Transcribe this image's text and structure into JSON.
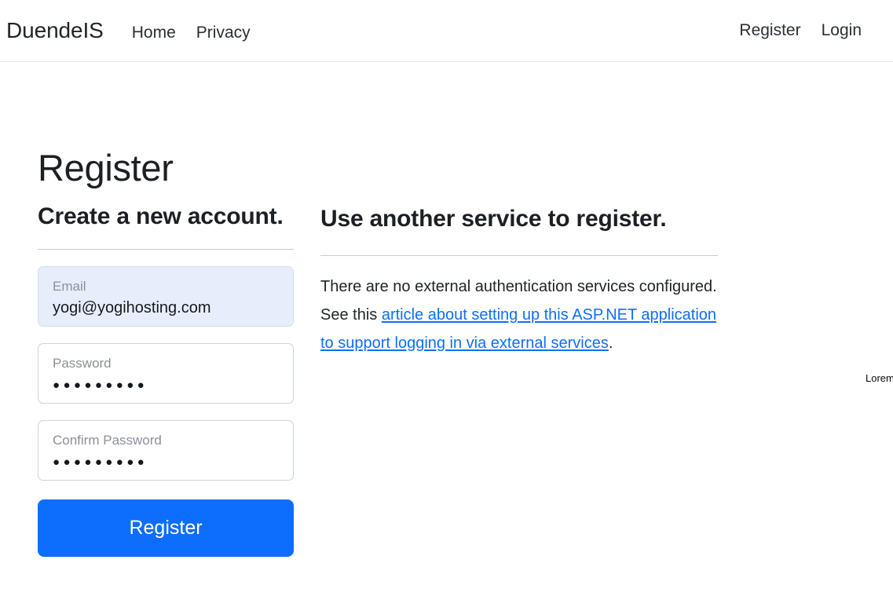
{
  "navbar": {
    "brand": "DuendeIS",
    "links": [
      {
        "label": "Home"
      },
      {
        "label": "Privacy"
      }
    ],
    "auth_links": [
      {
        "label": "Register"
      },
      {
        "label": "Login"
      }
    ]
  },
  "page": {
    "title": "Register"
  },
  "form_section": {
    "heading": "Create a new account.",
    "fields": [
      {
        "name": "email",
        "label": "Email",
        "placeholder": "Email",
        "value": "yogi@yogihosting.com",
        "type": "email",
        "focused": true
      },
      {
        "name": "password",
        "label": "Password",
        "placeholder": "Password",
        "value": "●●●●●●●●●",
        "type": "password",
        "focused": false
      },
      {
        "name": "confirm-password",
        "label": "Confirm Password",
        "placeholder": "Confirm Password",
        "value": "●●●●●●●●●",
        "type": "password",
        "focused": false
      }
    ],
    "submit_label": "Register"
  },
  "external_section": {
    "heading": "Use another service to register.",
    "text_before": "There are no external authentication services configured. See this ",
    "link_text": "article about setting up this ASP.NET application to support logging in via external services",
    "text_after": "."
  },
  "stray": {
    "lorem": "Lorem"
  },
  "colors": {
    "primary": "#0d6efd",
    "link": "#0d6efd",
    "text": "#212529",
    "muted": "#8d9096",
    "field_focus_bg": "#e8edfb",
    "border": "#ced4da",
    "divider": "#c8cacd"
  }
}
